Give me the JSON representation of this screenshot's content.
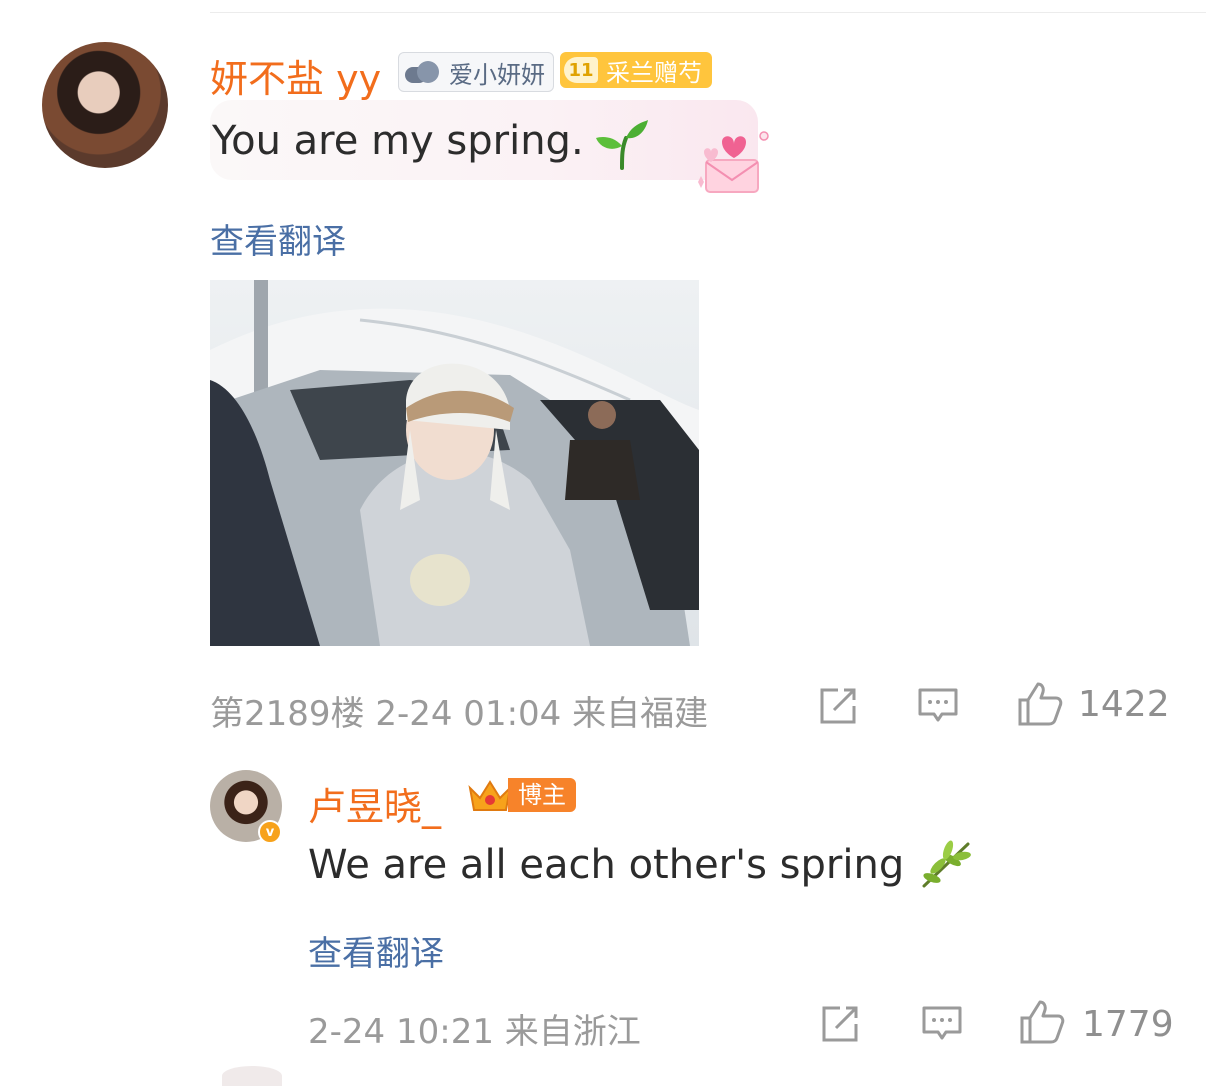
{
  "comments": [
    {
      "username": "妍不盐 yy",
      "fan_badge_text": "爱小妍妍",
      "level_badge": {
        "level": "11",
        "text": "采兰赠芍"
      },
      "text": "You are my spring.",
      "translate_label": "查看翻译",
      "meta": "第2189楼  2-24 01:04  来自福建",
      "like_count": "1422",
      "colors": {
        "username": "#f26d1c",
        "translate": "#4a6fa5",
        "meta": "#9a9a9a"
      }
    },
    {
      "username": "卢昱晓_",
      "role_badge_text": "博主",
      "text": "We are all each other's spring",
      "translate_label": "查看翻译",
      "meta": "2-24 10:21  来自浙江",
      "like_count": "1779"
    }
  ],
  "icons": {
    "share": "share-icon",
    "comment": "comment-icon",
    "like": "thumbs-up-icon",
    "sprout": "sprout-emoji-icon",
    "olive": "olive-branch-emoji-icon",
    "verified": "verified-v-icon"
  }
}
